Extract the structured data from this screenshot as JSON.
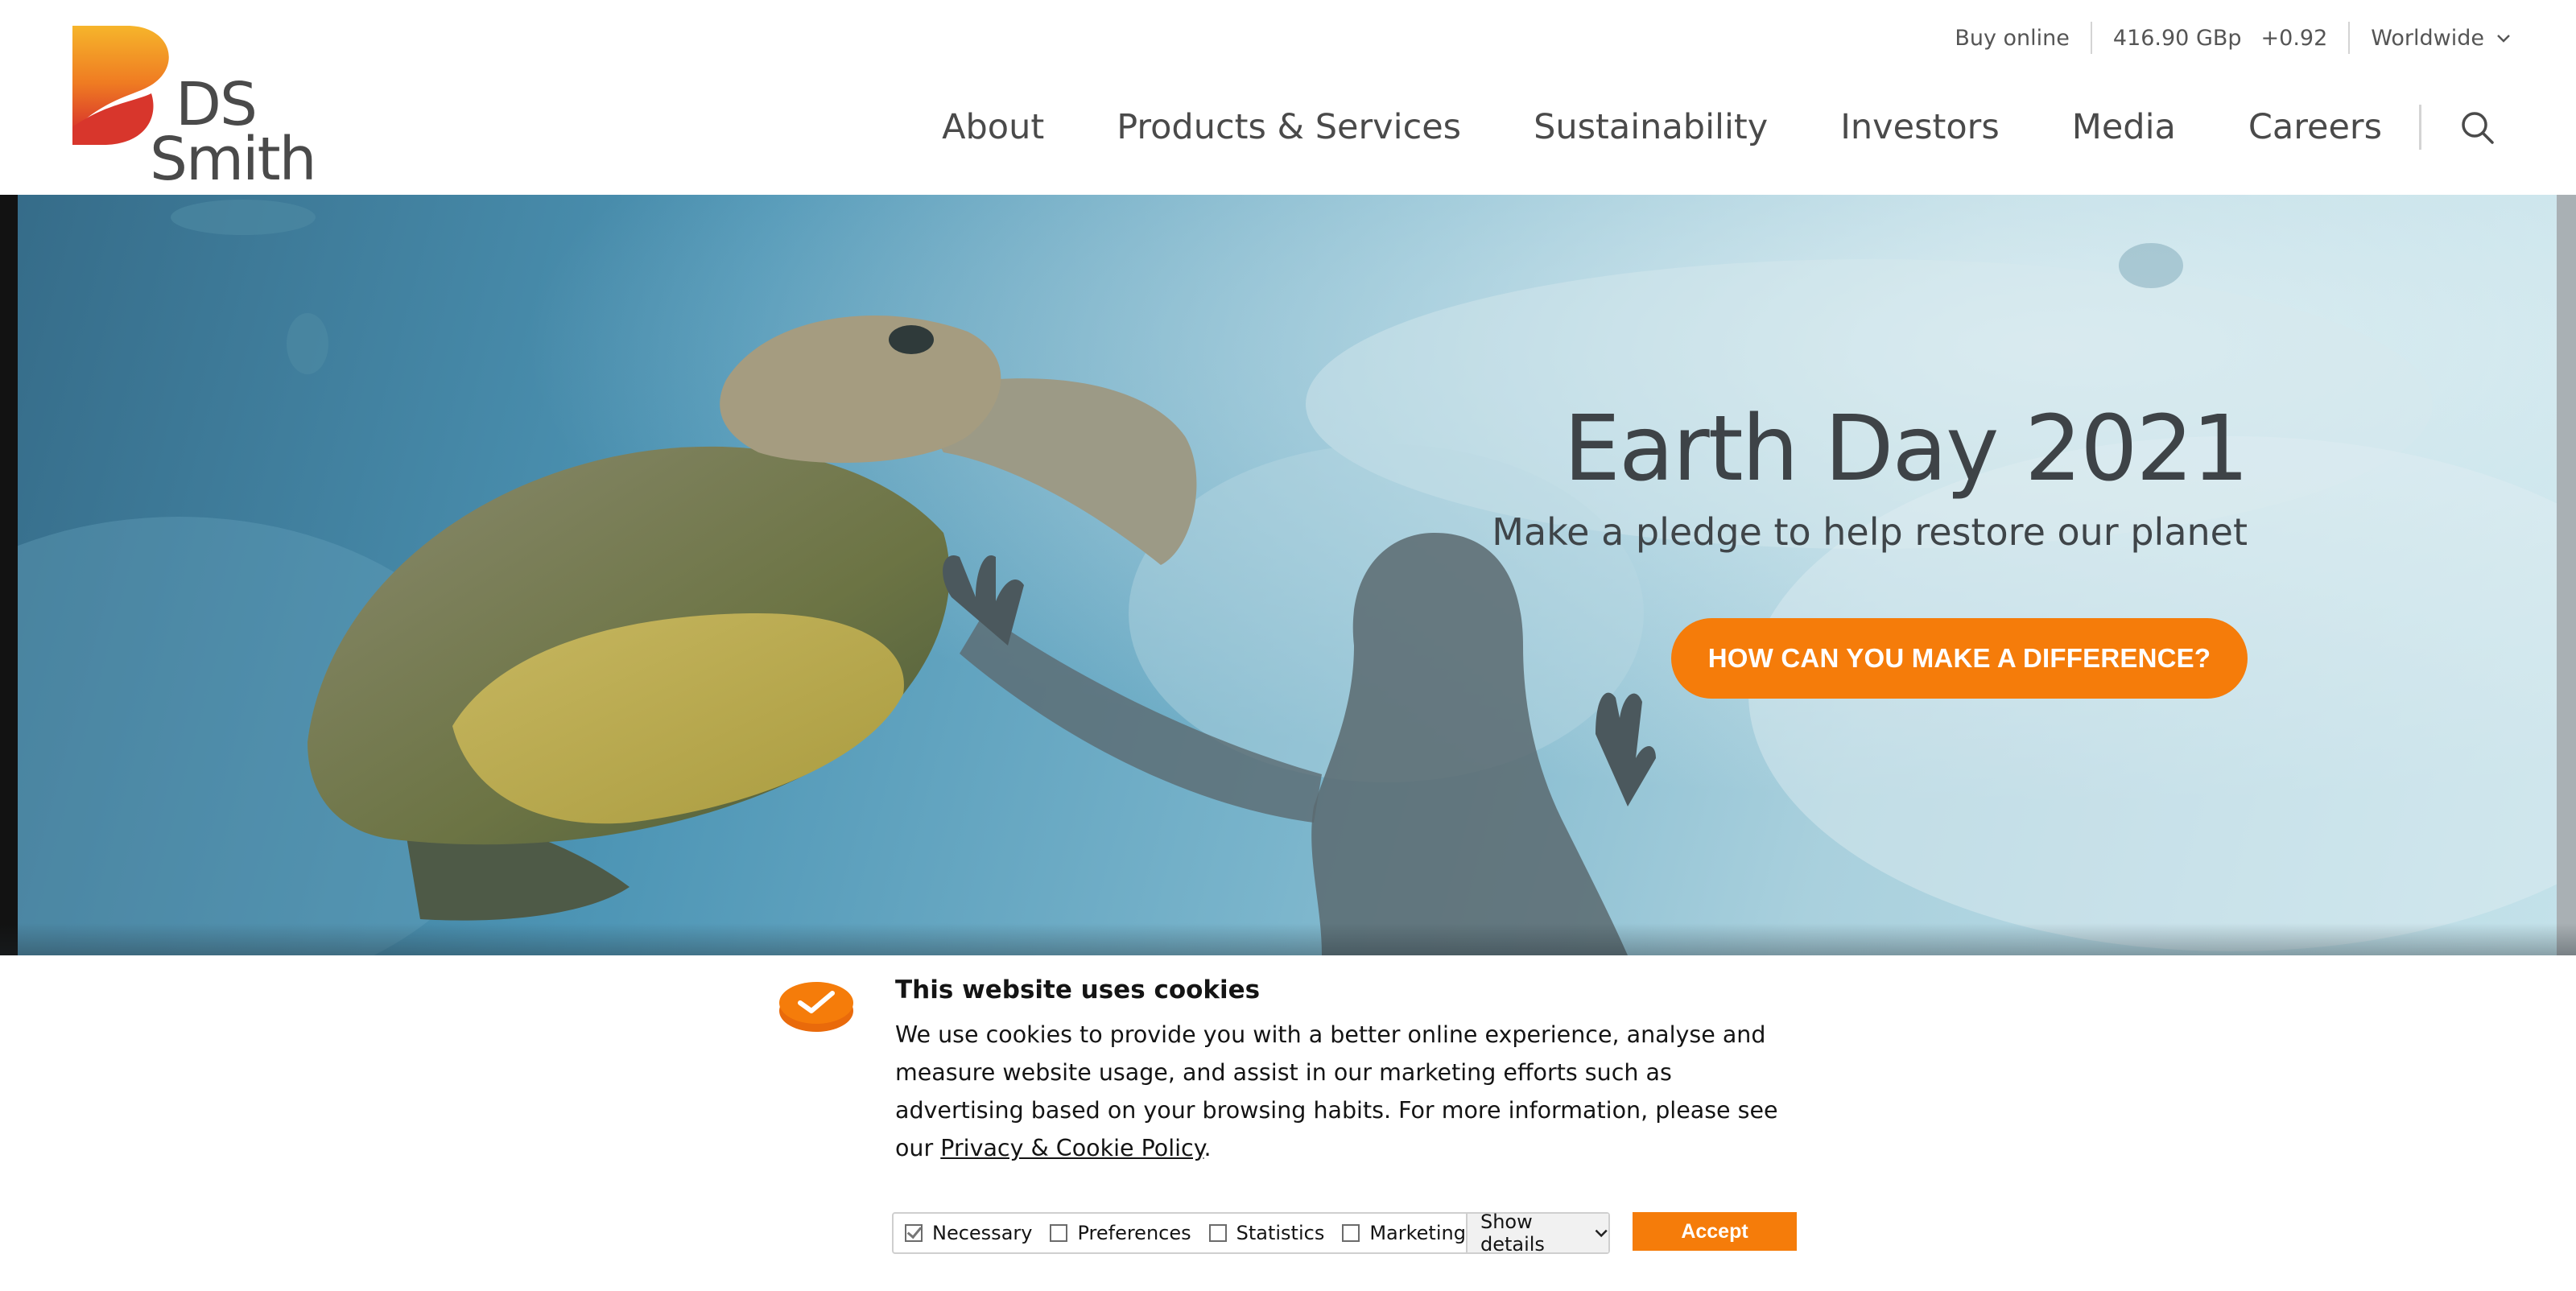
{
  "brand": {
    "logo_text_line1": "DS",
    "logo_text_line2": "Smith",
    "colors": {
      "accent_orange": "#f57c0a",
      "logo_red": "#e0442e",
      "logo_yellow": "#f6b52b",
      "text_gray": "#4a4a4a"
    }
  },
  "utility": {
    "buy_online": "Buy online",
    "share_price": "416.90 GBp",
    "share_change": "+0.92",
    "region": "Worldwide",
    "region_icon": "chevron-down-icon"
  },
  "nav": {
    "items": [
      {
        "label": "About"
      },
      {
        "label": "Products & Services"
      },
      {
        "label": "Sustainability"
      },
      {
        "label": "Investors"
      },
      {
        "label": "Media"
      },
      {
        "label": "Careers"
      }
    ],
    "search_icon": "search-icon"
  },
  "hero": {
    "title": "Earth Day 2021",
    "subtitle": "Make a pledge to help restore our planet",
    "cta_label": "HOW CAN YOU MAKE A DIFFERENCE?"
  },
  "cookie_banner": {
    "logo_icon": "cookie-check-icon",
    "title": "This website uses cookies",
    "body_text": "We use cookies to provide you with a better online experience, analyse and measure website usage, and assist in our marketing efforts such as advertising based on your browsing habits. For more information, please see our ",
    "policy_link": "Privacy & Cookie Policy",
    "body_end": ".",
    "options": [
      {
        "label": "Necessary",
        "checked": true
      },
      {
        "label": "Preferences",
        "checked": false
      },
      {
        "label": "Statistics",
        "checked": false
      },
      {
        "label": "Marketing",
        "checked": false
      }
    ],
    "show_details": "Show details",
    "accept": "Accept"
  }
}
